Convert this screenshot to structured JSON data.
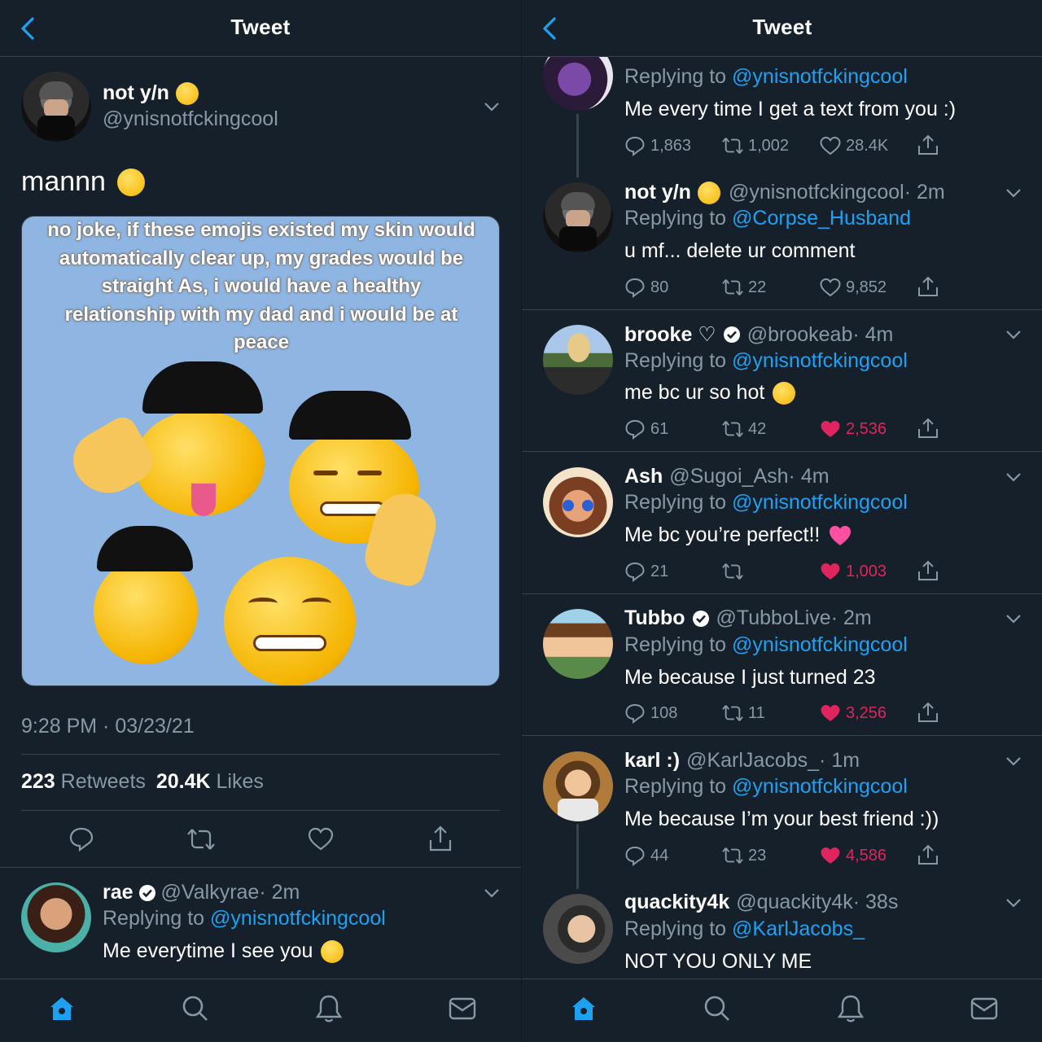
{
  "left": {
    "header_title": "Tweet",
    "tweet": {
      "display_name": "not y/n",
      "handle": "@ynisnotfckingcool",
      "text": "mannn",
      "image_text": "no joke, if these emojis existed my skin would automatically clear up, my grades would be straight As, i would have a healthy relationship with my dad and i would be at peace",
      "timestamp": "9:28 PM · 03/23/21",
      "retweets_count": "223",
      "retweets_label": "Retweets",
      "likes_count": "20.4K",
      "likes_label": "Likes"
    },
    "reply": {
      "display_name": "rae",
      "handle": "@Valkyrae",
      "time": "· 2m",
      "replying_label": "Replying to",
      "replying_to": "@ynisnotfckingcool",
      "text": "Me everytime I see you"
    }
  },
  "right": {
    "header_title": "Tweet",
    "replies": [
      {
        "replying_label": "Replying to",
        "replying_to": "@ynisnotfckingcool",
        "text": "Me every time I get a text from you :)",
        "replies": "1,863",
        "retweets": "1,002",
        "likes": "28.4K",
        "liked": false
      },
      {
        "display_name": "not y/n",
        "handle": "@ynisnotfckingcool",
        "time": "· 2m",
        "replying_label": "Replying to",
        "replying_to": "@Corpse_Husband",
        "text": "u mf... delete ur comment",
        "replies": "80",
        "retweets": "22",
        "likes": "9,852",
        "liked": false
      },
      {
        "display_name": "brooke ♡",
        "handle": "@brookeab",
        "time": "· 4m",
        "replying_label": "Replying to",
        "replying_to": "@ynisnotfckingcool",
        "text": "me bc ur so hot",
        "replies": "61",
        "retweets": "42",
        "likes": "2,536",
        "liked": true
      },
      {
        "display_name": "Ash",
        "handle": "@Sugoi_Ash",
        "time": "· 4m",
        "replying_label": "Replying to",
        "replying_to": "@ynisnotfckingcool",
        "text": "Me bc you’re perfect!!",
        "replies": "21",
        "retweets": "",
        "likes": "1,003",
        "liked": true
      },
      {
        "display_name": "Tubbo",
        "handle": "@TubboLive",
        "time": "· 2m",
        "replying_label": "Replying to",
        "replying_to": "@ynisnotfckingcool",
        "text": "Me because I just turned 23",
        "replies": "108",
        "retweets": "11",
        "likes": "3,256",
        "liked": true
      },
      {
        "display_name": "karl :)",
        "handle": "@KarlJacobs_",
        "time": "· 1m",
        "replying_label": "Replying to",
        "replying_to": "@ynisnotfckingcool",
        "text": "Me because I’m your best friend :))",
        "replies": "44",
        "retweets": "23",
        "likes": "4,586",
        "liked": true
      },
      {
        "display_name": "quackity4k",
        "handle": "@quackity4k",
        "time": "· 38s",
        "replying_label": "Replying to",
        "replying_to": "@KarlJacobs_",
        "text": "NOT YOU ONLY ME"
      }
    ]
  },
  "colors": {
    "background": "#15202b",
    "accent": "#1da1f2",
    "muted": "#8899a6",
    "like": "#e0245e",
    "divider": "#38444d",
    "image_bg": "#8fb5e2"
  },
  "icons": [
    "back-chevron-icon",
    "verified-badge-icon",
    "reply-icon",
    "retweet-icon",
    "like-icon",
    "share-icon",
    "home-icon",
    "search-icon",
    "notifications-icon",
    "messages-icon",
    "caret-down-icon"
  ]
}
